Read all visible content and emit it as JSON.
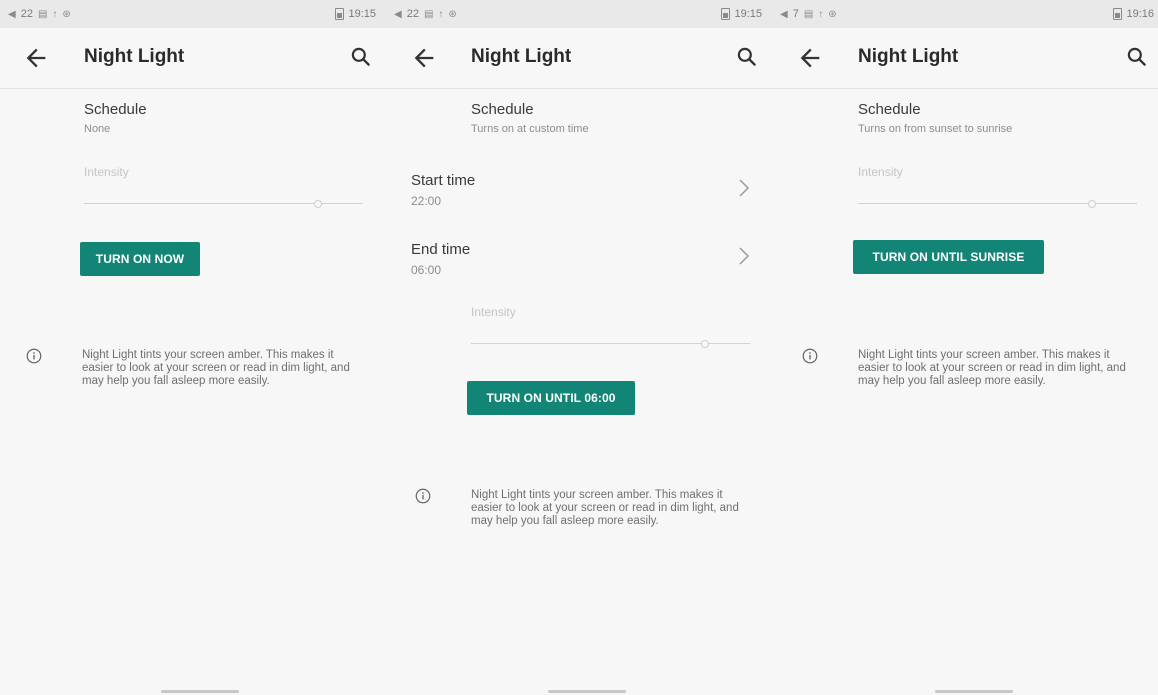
{
  "colors": {
    "accent": "#138576",
    "background": "#f7f7f7",
    "statusbar": "#e9e9e9"
  },
  "screens": [
    {
      "status": {
        "left_num": "22",
        "time": "19:15"
      },
      "appbar": {
        "title": "Night Light",
        "back_icon": "arrow-left-icon",
        "search_icon": "search-icon"
      },
      "schedule": {
        "label": "Schedule",
        "value": "None"
      },
      "intensity": {
        "label": "Intensity",
        "level": 0.84
      },
      "button": "TURN ON NOW",
      "info": {
        "icon": "info-icon",
        "text": "Night Light tints your screen amber. This makes it easier to look at your screen or read in dim light, and may help you fall asleep more easily."
      }
    },
    {
      "status": {
        "left_num": "22",
        "time": "19:15"
      },
      "appbar": {
        "title": "Night Light",
        "back_icon": "arrow-left-icon",
        "search_icon": "search-icon"
      },
      "schedule": {
        "label": "Schedule",
        "value": "Turns on at custom time"
      },
      "start_time": {
        "label": "Start time",
        "value": "22:00"
      },
      "end_time": {
        "label": "End time",
        "value": "06:00"
      },
      "intensity": {
        "label": "Intensity",
        "level": 0.84
      },
      "button": "TURN ON UNTIL 06:00",
      "info": {
        "icon": "info-icon",
        "text": "Night Light tints your screen amber. This makes it easier to look at your screen or read in dim light, and may help you fall asleep more easily."
      }
    },
    {
      "status": {
        "left_num": "7",
        "time": "19:16"
      },
      "appbar": {
        "title": "Night Light",
        "back_icon": "arrow-left-icon",
        "search_icon": "search-icon"
      },
      "schedule": {
        "label": "Schedule",
        "value": "Turns on from sunset to sunrise"
      },
      "intensity": {
        "label": "Intensity",
        "level": 0.84
      },
      "button": "TURN ON UNTIL SUNRISE",
      "info": {
        "icon": "info-icon",
        "text": "Night Light tints your screen amber. This makes it easier to look at your screen or read in dim light, and may help you fall asleep more easily."
      }
    }
  ]
}
